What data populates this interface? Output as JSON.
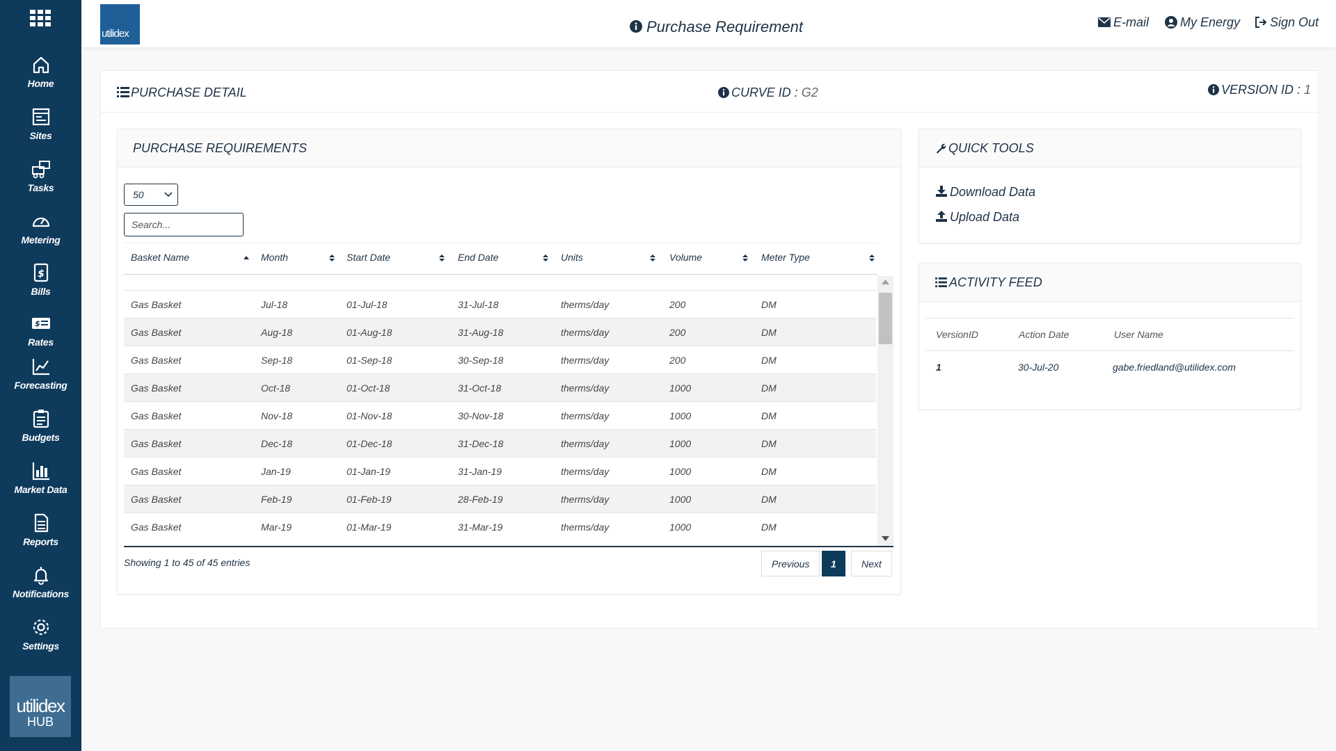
{
  "header": {
    "title": "Purchase Requirement",
    "email": "E-mail",
    "my_energy": "My Energy",
    "sign_out": "Sign Out",
    "logo_text": "utilidex"
  },
  "sidebar": {
    "items": [
      {
        "label": "Home",
        "icon": "home-icon"
      },
      {
        "label": "Sites",
        "icon": "sites-icon"
      },
      {
        "label": "Tasks",
        "icon": "tasks-icon"
      },
      {
        "label": "Metering",
        "icon": "gauge-icon"
      },
      {
        "label": "Bills",
        "icon": "bill-icon"
      },
      {
        "label": "Rates",
        "icon": "rates-icon"
      },
      {
        "label": "Forecasting",
        "icon": "forecast-chart-icon"
      },
      {
        "label": "Budgets",
        "icon": "clipboard-icon"
      },
      {
        "label": "Market Data",
        "icon": "bar-chart-icon"
      },
      {
        "label": "Reports",
        "icon": "report-icon"
      },
      {
        "label": "Notifications",
        "icon": "bell-icon"
      },
      {
        "label": "Settings",
        "icon": "gear-icon"
      }
    ],
    "hub_logo_line1": "utilidex",
    "hub_logo_line2": "HUB"
  },
  "detail": {
    "title": "PURCHASE DETAIL",
    "curve_label": "CURVE ID :",
    "curve_value": "G2",
    "version_label": "VERSION ID :",
    "version_value": "1"
  },
  "purchase": {
    "title": "PURCHASE REQUIREMENTS",
    "page_length": "50",
    "search_placeholder": "Search...",
    "columns": [
      "Basket Name",
      "Month",
      "Start Date",
      "End Date",
      "Units",
      "Volume",
      "Meter Type"
    ],
    "rows": [
      [
        "Gas Basket",
        "Jul-18",
        "01-Jul-18",
        "31-Jul-18",
        "therms/day",
        "200",
        "DM"
      ],
      [
        "Gas Basket",
        "Aug-18",
        "01-Aug-18",
        "31-Aug-18",
        "therms/day",
        "200",
        "DM"
      ],
      [
        "Gas Basket",
        "Sep-18",
        "01-Sep-18",
        "30-Sep-18",
        "therms/day",
        "200",
        "DM"
      ],
      [
        "Gas Basket",
        "Oct-18",
        "01-Oct-18",
        "31-Oct-18",
        "therms/day",
        "1000",
        "DM"
      ],
      [
        "Gas Basket",
        "Nov-18",
        "01-Nov-18",
        "30-Nov-18",
        "therms/day",
        "1000",
        "DM"
      ],
      [
        "Gas Basket",
        "Dec-18",
        "01-Dec-18",
        "31-Dec-18",
        "therms/day",
        "1000",
        "DM"
      ],
      [
        "Gas Basket",
        "Jan-19",
        "01-Jan-19",
        "31-Jan-19",
        "therms/day",
        "1000",
        "DM"
      ],
      [
        "Gas Basket",
        "Feb-19",
        "01-Feb-19",
        "28-Feb-19",
        "therms/day",
        "1000",
        "DM"
      ],
      [
        "Gas Basket",
        "Mar-19",
        "01-Mar-19",
        "31-Mar-19",
        "therms/day",
        "1000",
        "DM"
      ]
    ],
    "info": "Showing 1 to 45 of 45 entries",
    "pagination": {
      "previous": "Previous",
      "current": "1",
      "next": "Next"
    }
  },
  "quick_tools": {
    "title": "QUICK TOOLS",
    "download": "Download Data",
    "upload": "Upload Data"
  },
  "activity": {
    "title": "ACTIVITY FEED",
    "columns": [
      "VersionID",
      "Action Date",
      "User Name"
    ],
    "rows": [
      [
        "1",
        "30-Jul-20",
        "gabe.friedland@utilidex.com"
      ]
    ]
  },
  "colors": {
    "sidebar_bg": "#0e3a5c",
    "text_primary": "#1e3347",
    "logo_blue": "#1f5f98"
  }
}
